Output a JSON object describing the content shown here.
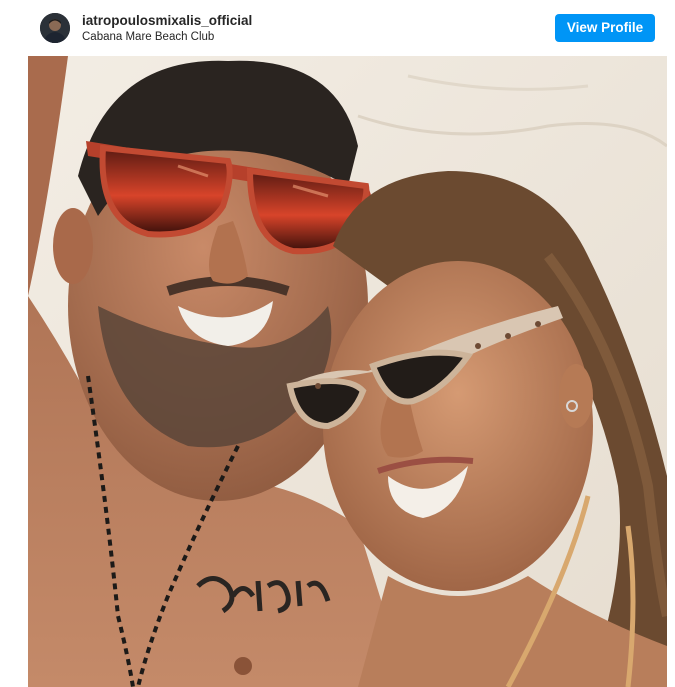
{
  "post": {
    "username": "iatropoulosmixalis_official",
    "location": "Cabana Mare Beach Club",
    "view_profile_label": "View Profile"
  },
  "colors": {
    "button_bg": "#0095f6",
    "button_text": "#ffffff",
    "text_primary": "#262626"
  },
  "icons": {
    "avatar": "profile-avatar-icon"
  }
}
